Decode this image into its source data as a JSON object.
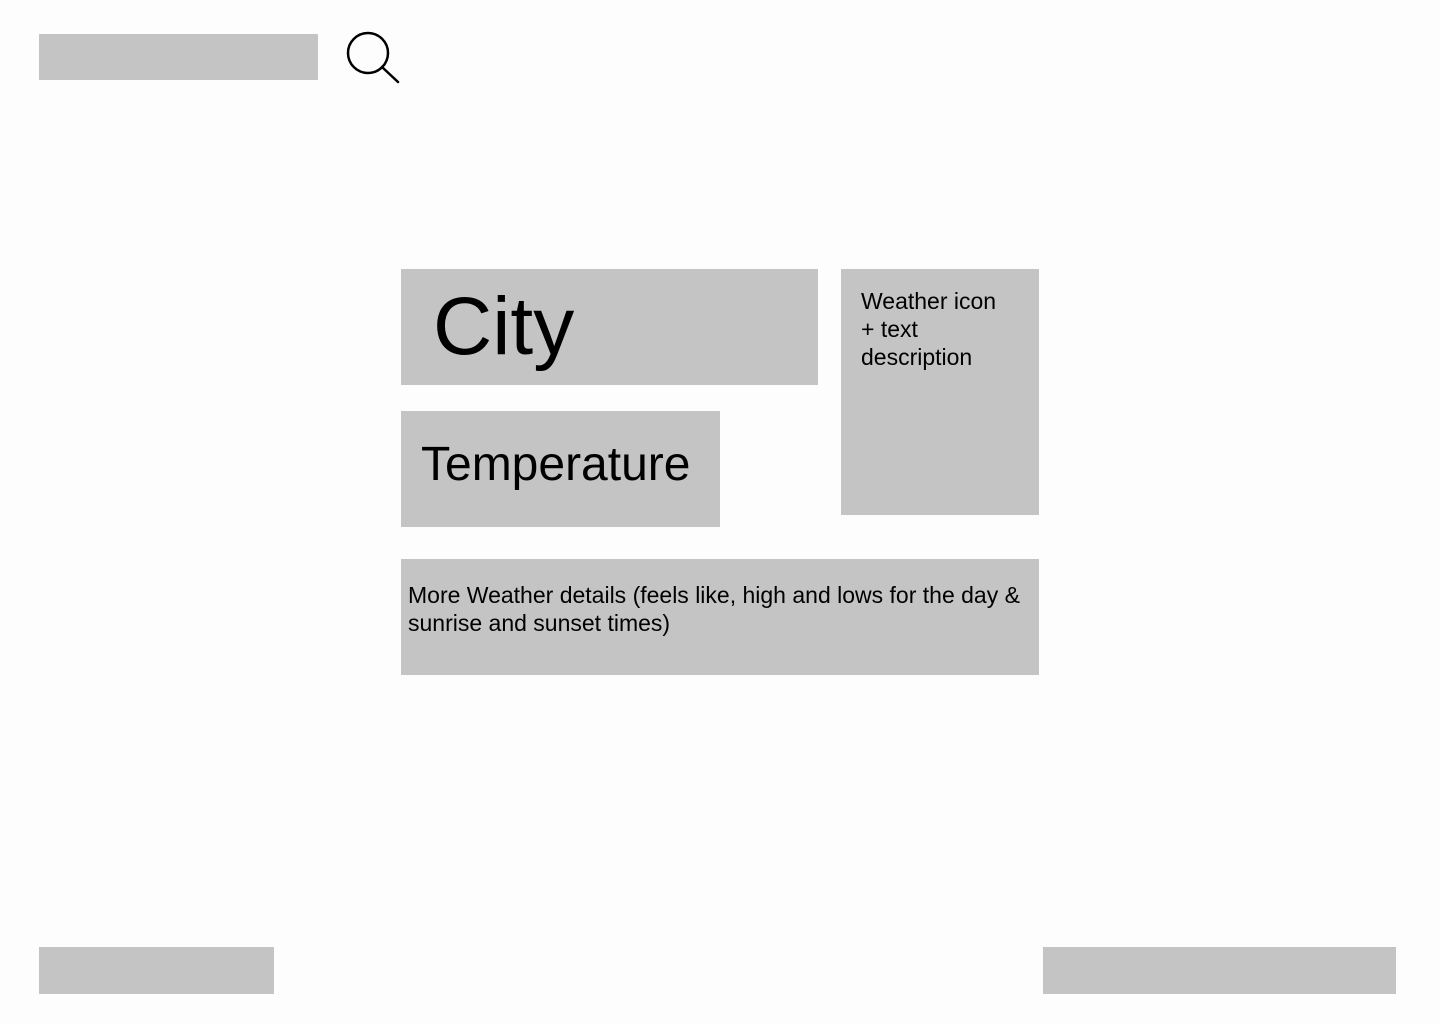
{
  "search": {
    "value": "",
    "placeholder": "",
    "button_icon": "search-icon"
  },
  "weather": {
    "city": "City",
    "temperature": "Temperature",
    "condition": "Weather icon + text description",
    "details": "More Weather details (feels like, high and lows for the day & sunrise and sunset times)"
  },
  "footer": {
    "left_label": "",
    "right_label": ""
  },
  "colors": {
    "background": "#fdfdfd",
    "placeholder_block": "#c4c4c4",
    "text": "#000000"
  }
}
